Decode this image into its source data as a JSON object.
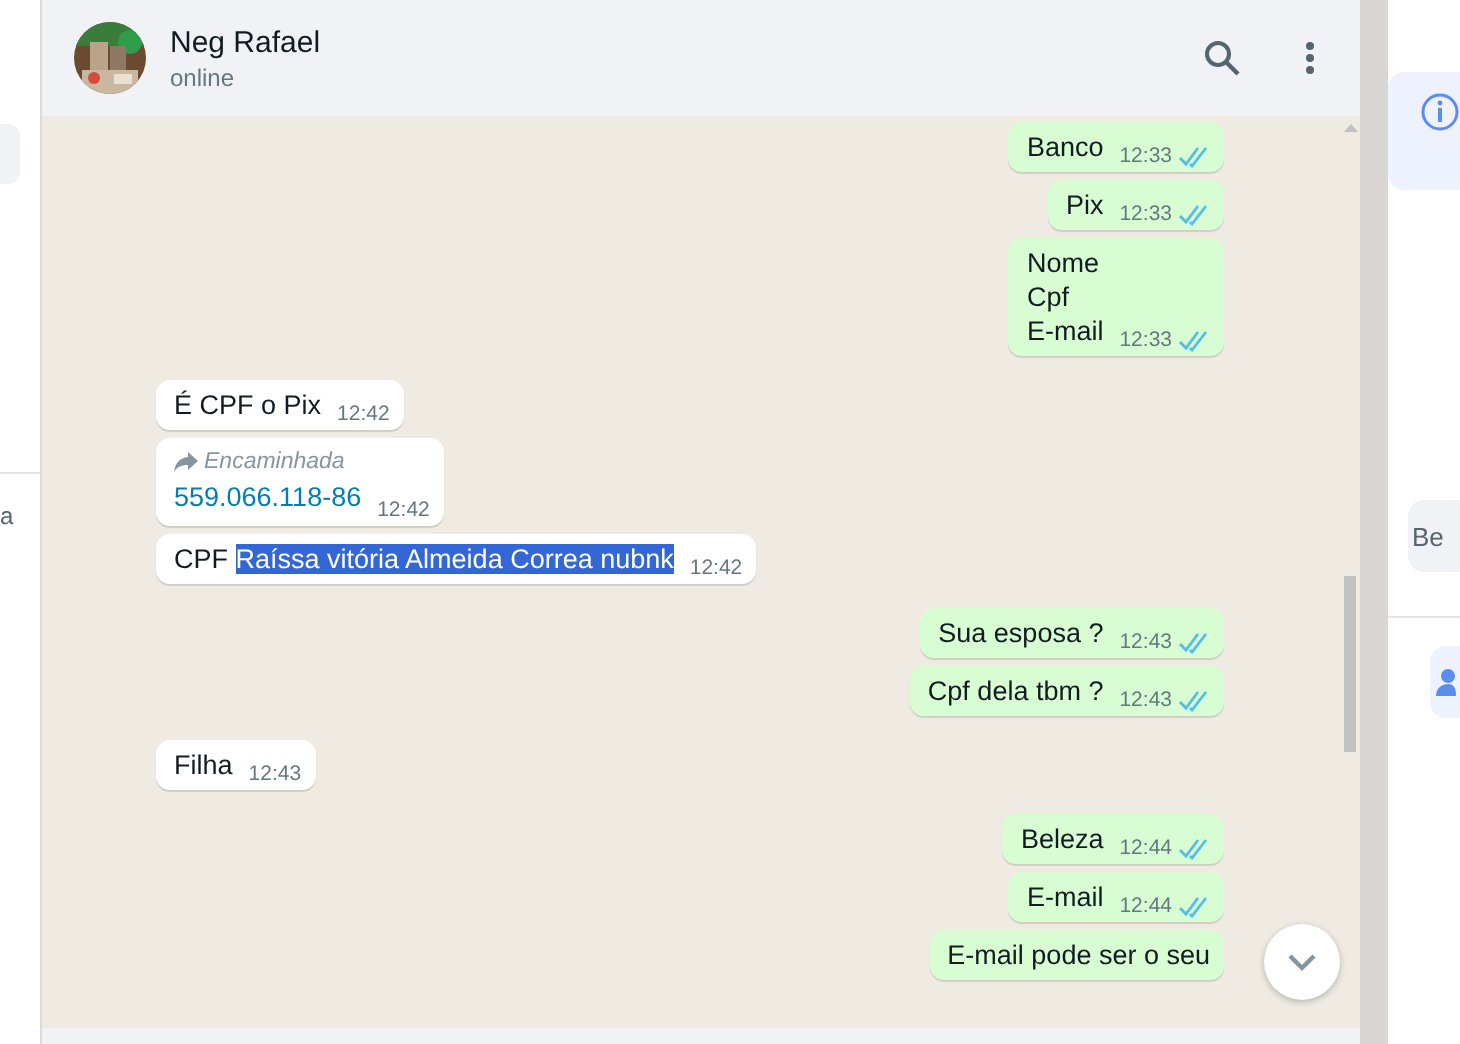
{
  "left_panel": {
    "fragment": "a"
  },
  "header": {
    "name": "Neg Rafael",
    "status": "online"
  },
  "messages": [
    {
      "kind": "out",
      "lines": [
        "Banco"
      ],
      "time": "12:33",
      "read": true
    },
    {
      "kind": "out",
      "lines": [
        "Pix"
      ],
      "time": "12:33",
      "read": true
    },
    {
      "kind": "out",
      "lines": [
        "Nome",
        "Cpf",
        "E-mail"
      ],
      "time": "12:33",
      "read": true
    },
    {
      "kind": "in",
      "lines": [
        "É CPF o Pix"
      ],
      "time": "12:42"
    },
    {
      "kind": "in",
      "forwarded_label": "Encaminhada",
      "link": "559.066.118-86",
      "time": "12:42"
    },
    {
      "kind": "in",
      "parts": [
        {
          "text": "CPF ",
          "highlighted": false
        },
        {
          "text": "Raíssa vitória Almeida Correa nubnk",
          "highlighted": true
        }
      ],
      "time": "12:42"
    },
    {
      "kind": "out",
      "lines": [
        "Sua esposa ?"
      ],
      "time": "12:43",
      "read": true
    },
    {
      "kind": "out",
      "lines": [
        "Cpf dela tbm ?"
      ],
      "time": "12:43",
      "read": true
    },
    {
      "kind": "in",
      "lines": [
        "Filha"
      ],
      "time": "12:43"
    },
    {
      "kind": "out",
      "lines": [
        "Beleza"
      ],
      "time": "12:44",
      "read": true
    },
    {
      "kind": "out",
      "lines": [
        "E-mail"
      ],
      "time": "12:44",
      "read": true
    },
    {
      "kind": "out",
      "lines": [
        "E-mail pode ser o seu"
      ]
    }
  ],
  "right_panel": {
    "button": "Be"
  }
}
